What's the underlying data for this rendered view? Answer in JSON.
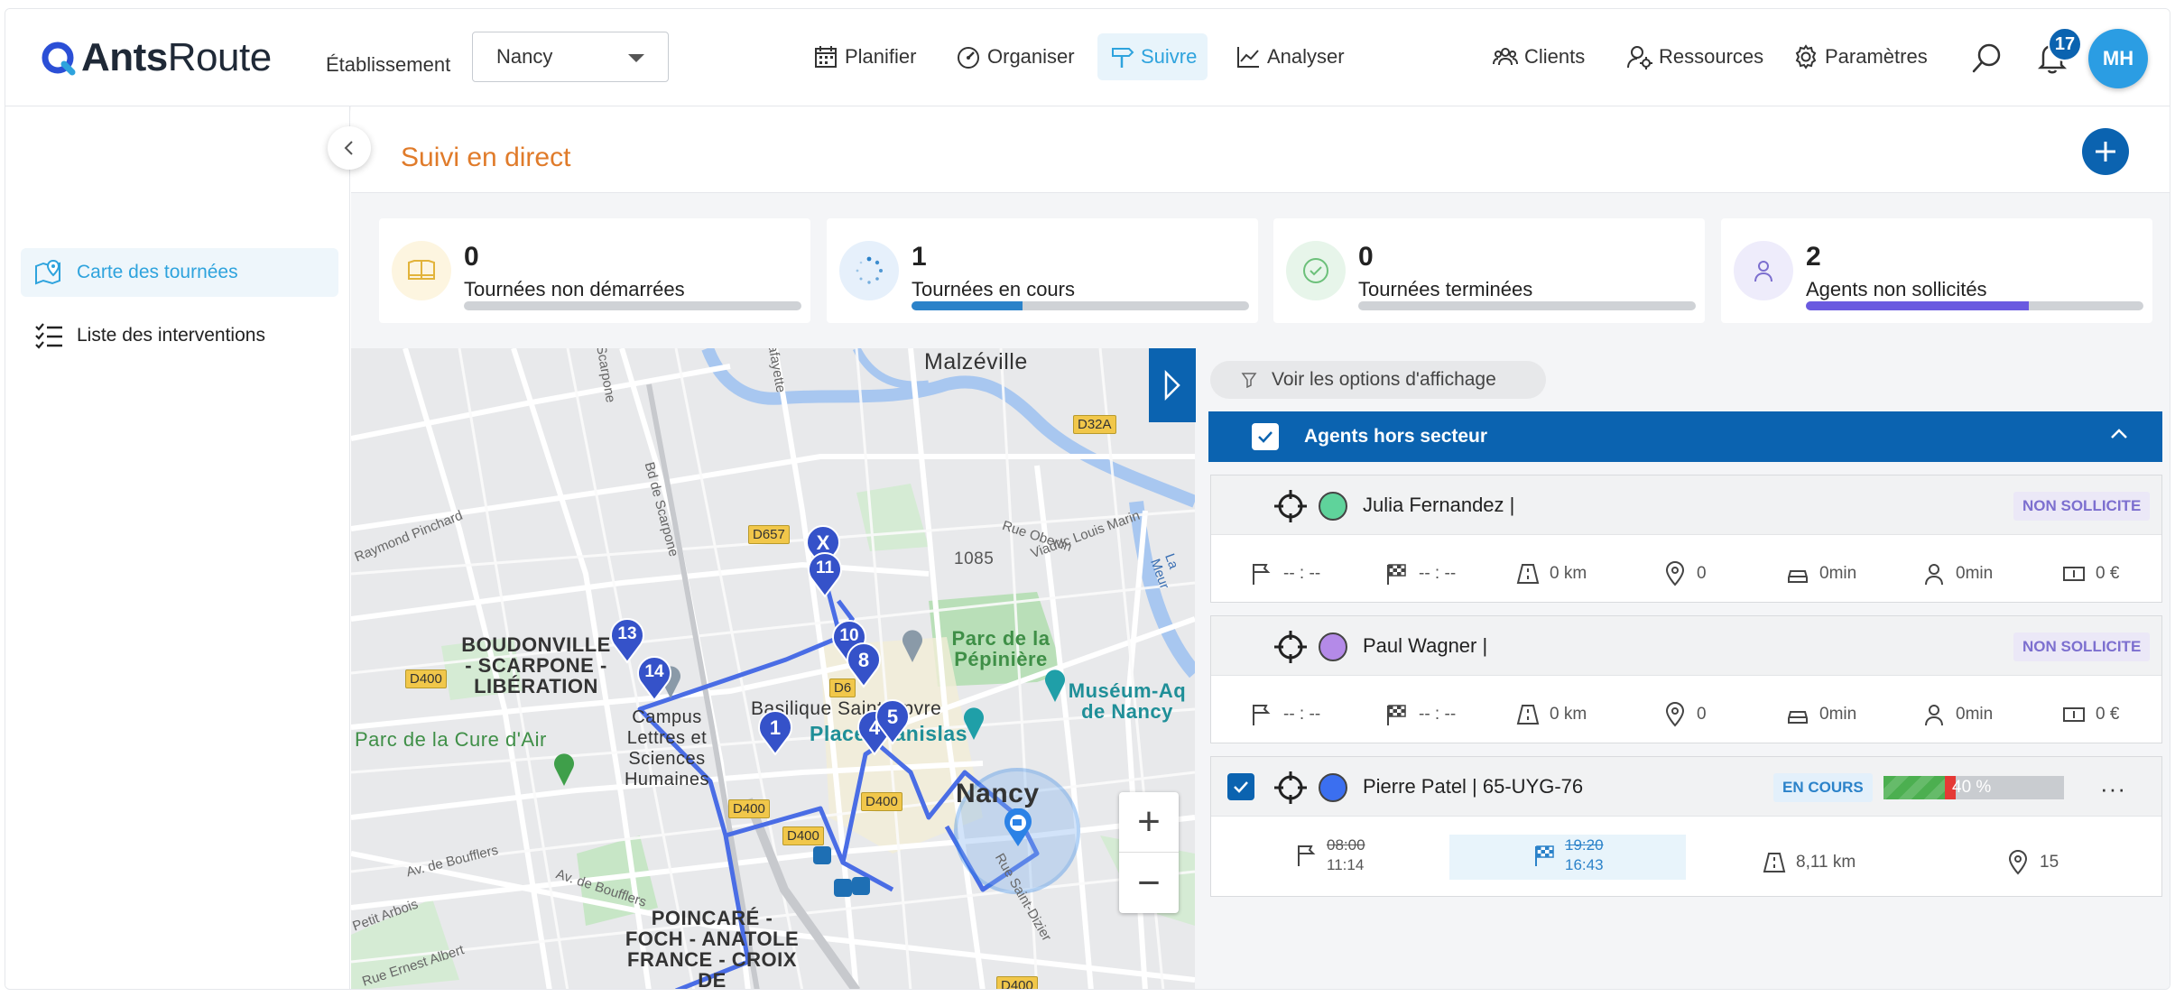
{
  "app": {
    "logo_brand": "Ants",
    "logo_suffix": "Route"
  },
  "header": {
    "etablissement_label": "Établissement",
    "etablissement_value": "Nancy",
    "nav": [
      {
        "label": "Planifier",
        "icon": "calendar-icon"
      },
      {
        "label": "Organiser",
        "icon": "gauge-icon"
      },
      {
        "label": "Suivre",
        "icon": "signpost-icon",
        "active": true
      },
      {
        "label": "Analyser",
        "icon": "chart-icon"
      },
      {
        "label": "Clients",
        "icon": "clients-icon"
      },
      {
        "label": "Ressources",
        "icon": "resources-icon"
      },
      {
        "label": "Paramètres",
        "icon": "gear-icon"
      }
    ],
    "notifications_count": "17",
    "user_initials": "MH"
  },
  "sidebar": {
    "items": [
      {
        "label": "Carte des tournées",
        "icon": "map-pin-icon",
        "active": true
      },
      {
        "label": "Liste des interventions",
        "icon": "checklist-icon"
      }
    ]
  },
  "page": {
    "title": "Suivi en direct"
  },
  "stats": [
    {
      "value": "0",
      "label": "Tournées non démarrées",
      "progress": 0,
      "color": "#f5c242"
    },
    {
      "value": "1",
      "label": "Tournées en cours",
      "progress": 0.33,
      "color": "#2b82c9"
    },
    {
      "value": "0",
      "label": "Tournées terminées",
      "progress": 0,
      "color": "#4caf50"
    },
    {
      "value": "2",
      "label": "Agents non sollicités",
      "progress": 0.66,
      "color": "#6a5ae0"
    }
  ],
  "map": {
    "places": [
      "Malzéville",
      "BOUDONVILLE - SCARPONE - LIBÉRATION",
      "Parc de la Pépinière",
      "Muséum-Aq de Nancy",
      "Basilique Saint-Epvre",
      "Place Stanislas",
      "Nancy",
      "Campus Lettres et Sciences Humaines",
      "Parc de la Cure d'Air",
      "POINCARÉ - FOCH - ANATOLE FRANCE - CROIX DE",
      "1085"
    ],
    "roads": [
      "Bd de Scarpone",
      "Rue Oberlin",
      "Viaduc Louis Marin",
      "Av. de Boufflers",
      "Raymond Pinchard",
      "Petit Arbois",
      "Rue Ernest Albert",
      "La Meur",
      "Rue Saint-Dizier",
      "Scarpone",
      "Lafayette"
    ],
    "shields": [
      "D32A",
      "D657",
      "D400",
      "D400",
      "D400",
      "D400",
      "D400",
      "D6"
    ],
    "markers": [
      "X",
      "11",
      "13",
      "14",
      "10",
      "8",
      "1",
      "4",
      "5"
    ],
    "zoom_in": "+",
    "zoom_out": "−"
  },
  "panel": {
    "options_label": "Voir les options d'affichage",
    "group_label": "Agents hors secteur",
    "agents": [
      {
        "name": "Julia Fernandez |",
        "status": "NON SOLLICITE",
        "color": "#5fd39b",
        "metrics": {
          "start": "-- : --",
          "end": "-- : --",
          "distance": "0 km",
          "stops": "0",
          "drive": "0min",
          "work": "0min",
          "cost": "0 €"
        }
      },
      {
        "name": "Paul Wagner |",
        "status": "NON SOLLICITE",
        "color": "#b48ae8",
        "metrics": {
          "start": "-- : --",
          "end": "-- : --",
          "distance": "0 km",
          "stops": "0",
          "drive": "0min",
          "work": "0min",
          "cost": "0 €"
        }
      },
      {
        "name": "Pierre Patel | 65-UYG-76",
        "status": "EN COURS",
        "color": "#3b6ff0",
        "progress_label": "40 %",
        "progress": 0.4,
        "times": {
          "start_planned": "08:00",
          "start_actual": "11:14",
          "end_planned": "19:20",
          "end_actual": "16:43",
          "distance": "8,11 km",
          "stops": "15"
        },
        "more": "···"
      }
    ]
  }
}
